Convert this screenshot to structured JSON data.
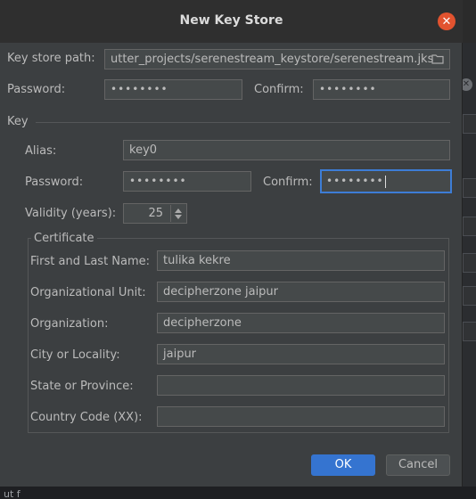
{
  "window": {
    "title": "New Key Store",
    "close_symbol": "✕"
  },
  "keystore": {
    "path_label": "Key store path:",
    "path_value": "utter_projects/serenestream_keystore/serenestream.jks",
    "password_label": "Password:",
    "password_value": "••••••••",
    "confirm_label": "Confirm:",
    "confirm_value": "••••••••"
  },
  "key": {
    "section_label": "Key",
    "alias_label": "Alias:",
    "alias_value": "key0",
    "password_label": "Password:",
    "password_value": "••••••••",
    "confirm_label": "Confirm:",
    "confirm_value": "••••••••",
    "validity_label": "Validity (years):",
    "validity_value": "25"
  },
  "certificate": {
    "section_label": "Certificate",
    "fields": [
      {
        "label": "First and Last Name:",
        "value": "tulika kekre"
      },
      {
        "label": "Organizational Unit:",
        "value": "decipherzone jaipur"
      },
      {
        "label": "Organization:",
        "value": "decipherzone"
      },
      {
        "label": "City or Locality:",
        "value": "jaipur"
      },
      {
        "label": "State or Province:",
        "value": ""
      },
      {
        "label": "Country Code (XX):",
        "value": ""
      }
    ]
  },
  "buttons": {
    "ok_label": "OK",
    "cancel_label": "Cancel"
  },
  "backdrop": {
    "bottom_text": "ut f"
  },
  "colors": {
    "dialog_bg": "#3c3f41",
    "accent": "#3574d0",
    "close_button": "#e2532f",
    "focus_border": "#3d7dd6"
  }
}
